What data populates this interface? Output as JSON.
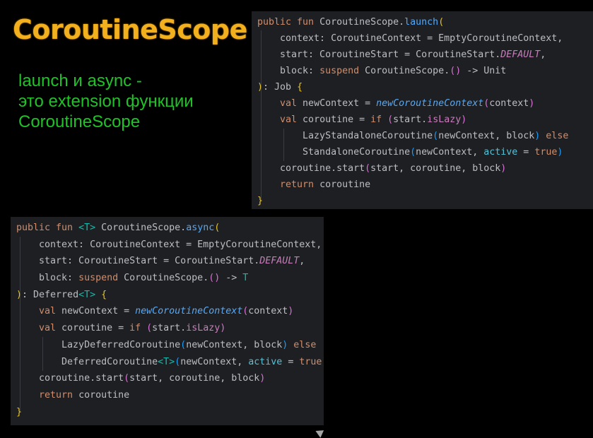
{
  "slide": {
    "title": "CoroutineScope",
    "subtitle_lines": [
      "launch и async -",
      "это extension функции",
      "CoroutineScope"
    ]
  },
  "colors": {
    "background": "#000000",
    "title": "#f2b01e",
    "subtitle": "#21c12a",
    "code_background": "#1e1f22",
    "keyword": "#cf8e6d",
    "function": "#56a8f5",
    "constant": "#c77dbb"
  },
  "launch_code": {
    "l1": {
      "a": "public fun ",
      "b": "CoroutineScope.",
      "c": "launch",
      "d": "("
    },
    "l2": "    context: CoroutineContext = EmptyCoroutineContext,",
    "l3": {
      "a": "    start: CoroutineStart = CoroutineStart.",
      "b": "DEFAULT",
      "c": ","
    },
    "l4": {
      "a": "    block: ",
      "b": "suspend",
      "c": " CoroutineScope.",
      "d": "()",
      "e": " -> Unit"
    },
    "l5": {
      "a": ")",
      "b": ": Job ",
      "c": "{"
    },
    "l6": {
      "a": "    val",
      "b": " newContext = ",
      "c": "newCoroutineContext",
      "d": "(",
      "e": "context",
      "f": ")"
    },
    "l7": {
      "a": "    val",
      "b": " coroutine = ",
      "c": "if",
      "d": " (",
      "e": "start.",
      "f": "isLazy",
      "g": ")"
    },
    "l8": {
      "a": "        LazyStandaloneCoroutine",
      "b": "(",
      "c": "newContext, block",
      "d": ")",
      "e": " else"
    },
    "l9": {
      "a": "        StandaloneCoroutine",
      "b": "(",
      "c": "newContext, ",
      "d": "active",
      "e": " = ",
      "f": "true",
      "g": ")"
    },
    "l10": {
      "a": "    coroutine.start",
      "b": "(",
      "c": "start, coroutine, block",
      "d": ")"
    },
    "l11": {
      "a": "    return",
      "b": " coroutine"
    },
    "l12": "}"
  },
  "async_code": {
    "l1": {
      "a": "public fun ",
      "b": "<T>",
      "c": " CoroutineScope.",
      "d": "async",
      "e": "("
    },
    "l2": "    context: CoroutineContext = EmptyCoroutineContext,",
    "l3": {
      "a": "    start: CoroutineStart = CoroutineStart.",
      "b": "DEFAULT",
      "c": ","
    },
    "l4": {
      "a": "    block: ",
      "b": "suspend",
      "c": " CoroutineScope.",
      "d": "()",
      "e": " -> ",
      "f": "T"
    },
    "l5": {
      "a": ")",
      "b": ": Deferred",
      "c": "<T>",
      "d": " ",
      "e": "{"
    },
    "l6": {
      "a": "    val",
      "b": " newContext = ",
      "c": "newCoroutineContext",
      "d": "(",
      "e": "context",
      "f": ")"
    },
    "l7": {
      "a": "    val",
      "b": " coroutine = ",
      "c": "if",
      "d": " (",
      "e": "start.",
      "f": "isLazy",
      "g": ")"
    },
    "l8": {
      "a": "        LazyDeferredCoroutine",
      "b": "(",
      "c": "newContext, block",
      "d": ")",
      "e": " else"
    },
    "l9": {
      "a": "        DeferredCoroutine",
      "b": "<T>",
      "c": "(",
      "d": "newContext, ",
      "e": "active",
      "f": " = ",
      "g": "true",
      "h": ")"
    },
    "l10": {
      "a": "    coroutine.start",
      "b": "(",
      "c": "start, coroutine, block",
      "d": ")"
    },
    "l11": {
      "a": "    return",
      "b": " coroutine"
    },
    "l12": "}"
  }
}
